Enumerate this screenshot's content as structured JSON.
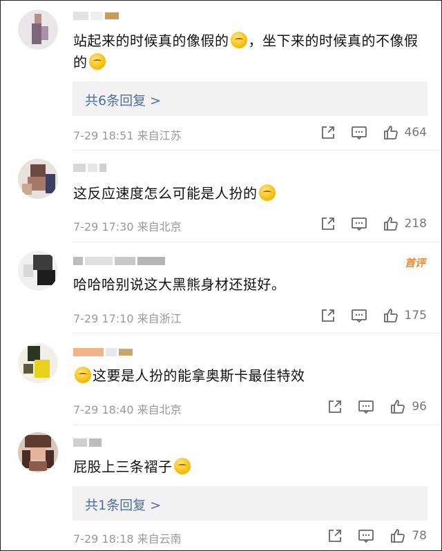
{
  "comments": [
    {
      "text": "站起来的时候真的像假的",
      "text_2": "，坐下来的时候真的不像假的",
      "emoji_1": "thinking-emoji",
      "emoji_2": "nerd-emoji",
      "replies": "共6条回复 >",
      "time": "7-29 18:51",
      "location": "来自江苏",
      "likes": "464"
    },
    {
      "text": "这反应速度怎么可能是人扮的",
      "emoji_1": "laughing-tears-emoji",
      "time": "7-29 17:30",
      "location": "来自北京",
      "likes": "218"
    },
    {
      "text": "哈哈哈别说这大黑熊身材还挺好。",
      "badge": "首评",
      "time": "7-29 17:10",
      "location": "来自浙江",
      "likes": "175"
    },
    {
      "text": "这要是人扮的能拿奥斯卡最佳特效",
      "emoji_1": "smile-emoji",
      "time": "7-29 18:40",
      "location": "来自北京",
      "likes": "96"
    },
    {
      "text": "屁股上三条褶子",
      "emoji_1": "thinking-emoji",
      "replies": "共1条回复 >",
      "time": "7-29 18:18",
      "location": "来自云南",
      "likes": "78"
    }
  ],
  "colors": {
    "reply_link": "#4a6fa8",
    "meta": "#999999",
    "badge": "#f08a2b",
    "reply_bg": "#f2f2f2"
  }
}
